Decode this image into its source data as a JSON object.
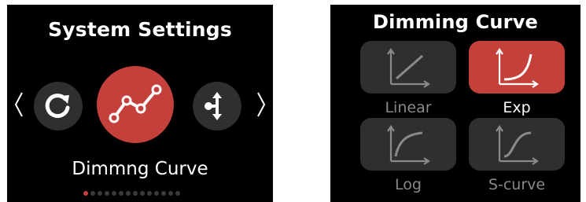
{
  "left_screen": {
    "title": "System Settings",
    "caption": "Dimmng Curve",
    "icons": [
      "refresh-icon",
      "line-chart-icon",
      "network-icon"
    ],
    "page_dots": {
      "count": 14,
      "active_index": 0
    },
    "accent": "#c4403a"
  },
  "right_screen": {
    "title": "Dimming Curve",
    "options": [
      {
        "label": "Linear",
        "selected": false
      },
      {
        "label": "Exp",
        "selected": true
      },
      {
        "label": "Log",
        "selected": false
      },
      {
        "label": "S-curve",
        "selected": false
      }
    ]
  }
}
